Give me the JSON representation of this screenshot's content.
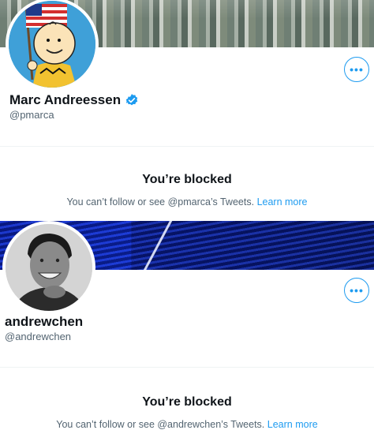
{
  "profiles": [
    {
      "display_name": "Marc Andreessen",
      "verified": true,
      "handle": "@pmarca",
      "more_label": "•••",
      "blocked_title": "You’re blocked",
      "blocked_desc": "You can’t follow or see @pmarca’s Tweets.",
      "learn_more": "Learn more"
    },
    {
      "display_name": "andrewchen",
      "verified": false,
      "handle": "@andrewchen",
      "more_label": "•••",
      "blocked_title": "You’re blocked",
      "blocked_desc": "You can’t follow or see @andrewchen’s Tweets.",
      "learn_more": "Learn more"
    }
  ],
  "colors": {
    "accent": "#1d9bf0",
    "secondary_text": "#536471",
    "primary_text": "#0f1419"
  }
}
